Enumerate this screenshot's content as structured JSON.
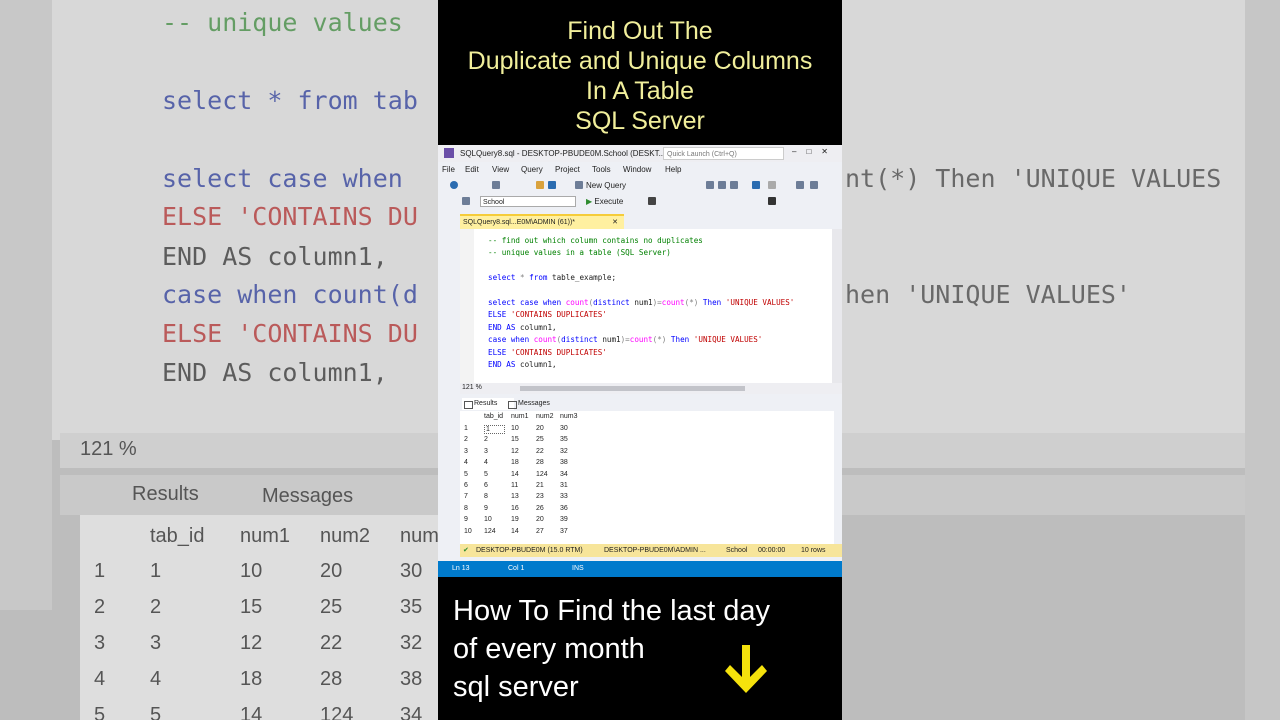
{
  "video": {
    "top_title_lines": [
      "Find Out The",
      "Duplicate and Unique Columns",
      "In A Table",
      "SQL Server"
    ],
    "bottom_title_lines": [
      "How To Find the last day",
      "of every month",
      "sql server"
    ],
    "arrow_icon": "arrow-down-icon",
    "accent_color": "#f1ef9b",
    "arrow_color": "#f5e20c"
  },
  "background": {
    "code_lines": [
      {
        "text": "-- unique values",
        "cls": "cmt"
      },
      {
        "text": "select * from tab",
        "cls": "kw"
      },
      {
        "text": "select case when",
        "cls": "kw"
      },
      {
        "text": "ELSE 'CONTAINS DU",
        "cls": "str"
      },
      {
        "text": "END AS column1,",
        "cls": "plain"
      },
      {
        "text": "case when count(d",
        "cls": "kw"
      },
      {
        "text": "ELSE 'CONTAINS DU",
        "cls": "str"
      },
      {
        "text": "END AS column1,",
        "cls": "plain"
      }
    ],
    "right_snippets": [
      "nt(*) Then 'UNIQUE VALUES",
      "hen 'UNIQUE VALUES'"
    ],
    "zoom": "121 %",
    "results_tab": "Results",
    "messages_tab": "Messages",
    "grid_headers": [
      "tab_id",
      "num1",
      "num2",
      "num"
    ],
    "grid_rows": [
      [
        "1",
        "1",
        "10",
        "20",
        "30"
      ],
      [
        "2",
        "2",
        "15",
        "25",
        "35"
      ],
      [
        "3",
        "3",
        "12",
        "22",
        "32"
      ],
      [
        "4",
        "4",
        "18",
        "28",
        "38"
      ],
      [
        "5",
        "5",
        "14",
        "124",
        "34"
      ]
    ]
  },
  "ssms": {
    "window_title": "SQLQuery8.sql - DESKTOP-PBUDE0M.School (DESKT...",
    "quick_launch_placeholder": "Quick Launch (Ctrl+Q)",
    "menu": [
      "File",
      "Edit",
      "View",
      "Query",
      "Project",
      "Tools",
      "Window",
      "Help"
    ],
    "new_query_label": "New Query",
    "database": "School",
    "execute_label": "Execute",
    "doc_tab": "SQLQuery8.sql...E0M\\ADMIN (61))*",
    "code_lines": [
      [
        {
          "t": "-- find out which column contains no duplicates",
          "c": "cmt"
        }
      ],
      [
        {
          "t": "-- unique values in a table (SQL Server)",
          "c": "cmt"
        }
      ],
      [
        {
          "t": "",
          "c": ""
        }
      ],
      [
        {
          "t": "select",
          "c": "kw"
        },
        {
          "t": " ",
          "c": ""
        },
        {
          "t": "*",
          "c": "op"
        },
        {
          "t": " ",
          "c": ""
        },
        {
          "t": "from",
          "c": "kw"
        },
        {
          "t": " table_example;",
          "c": ""
        }
      ],
      [
        {
          "t": "",
          "c": ""
        }
      ],
      [
        {
          "t": "select case when",
          "c": "kw"
        },
        {
          "t": " ",
          "c": ""
        },
        {
          "t": "count",
          "c": "fn"
        },
        {
          "t": "(",
          "c": "op"
        },
        {
          "t": "distinct",
          "c": "kw"
        },
        {
          "t": " num1",
          "c": ""
        },
        {
          "t": ")=",
          "c": "op"
        },
        {
          "t": "count",
          "c": "fn"
        },
        {
          "t": "(*)",
          "c": "op"
        },
        {
          "t": " ",
          "c": ""
        },
        {
          "t": "Then",
          "c": "kw"
        },
        {
          "t": " ",
          "c": ""
        },
        {
          "t": "'UNIQUE VALUES'",
          "c": "str"
        }
      ],
      [
        {
          "t": "ELSE",
          "c": "kw"
        },
        {
          "t": " ",
          "c": ""
        },
        {
          "t": "'CONTAINS DUPLICATES'",
          "c": "str"
        }
      ],
      [
        {
          "t": "END AS",
          "c": "kw"
        },
        {
          "t": " column1,",
          "c": ""
        }
      ],
      [
        {
          "t": "case when",
          "c": "kw"
        },
        {
          "t": " ",
          "c": ""
        },
        {
          "t": "count",
          "c": "fn"
        },
        {
          "t": "(",
          "c": "op"
        },
        {
          "t": "distinct",
          "c": "kw"
        },
        {
          "t": " num1",
          "c": ""
        },
        {
          "t": ")=",
          "c": "op"
        },
        {
          "t": "count",
          "c": "fn"
        },
        {
          "t": "(*)",
          "c": "op"
        },
        {
          "t": " ",
          "c": ""
        },
        {
          "t": "Then",
          "c": "kw"
        },
        {
          "t": " ",
          "c": ""
        },
        {
          "t": "'UNIQUE VALUES'",
          "c": "str"
        }
      ],
      [
        {
          "t": "ELSE",
          "c": "kw"
        },
        {
          "t": " ",
          "c": ""
        },
        {
          "t": "'CONTAINS DUPLICATES'",
          "c": "str"
        }
      ],
      [
        {
          "t": "END AS",
          "c": "kw"
        },
        {
          "t": " column1,",
          "c": ""
        }
      ]
    ],
    "zoom": "121 %",
    "results_tab": "Results",
    "messages_tab": "Messages",
    "grid_headers": [
      "tab_id",
      "num1",
      "num2",
      "num3"
    ],
    "grid_rows": [
      [
        "1",
        "1",
        "10",
        "20",
        "30"
      ],
      [
        "2",
        "2",
        "15",
        "25",
        "35"
      ],
      [
        "3",
        "3",
        "12",
        "22",
        "32"
      ],
      [
        "4",
        "4",
        "18",
        "28",
        "38"
      ],
      [
        "5",
        "5",
        "14",
        "124",
        "34"
      ],
      [
        "6",
        "6",
        "11",
        "21",
        "31"
      ],
      [
        "7",
        "8",
        "13",
        "23",
        "33"
      ],
      [
        "8",
        "9",
        "16",
        "26",
        "36"
      ],
      [
        "9",
        "10",
        "19",
        "20",
        "39"
      ],
      [
        "10",
        "124",
        "14",
        "27",
        "37"
      ]
    ],
    "status": {
      "server": "DESKTOP-PBUDE0M (15.0 RTM)",
      "user": "DESKTOP-PBUDE0M\\ADMIN ...",
      "db": "School",
      "time": "00:00:00",
      "rows": "10 rows"
    },
    "bottom_bar": {
      "ln": "Ln 13",
      "col": "Col 1",
      "mode": "INS"
    }
  }
}
